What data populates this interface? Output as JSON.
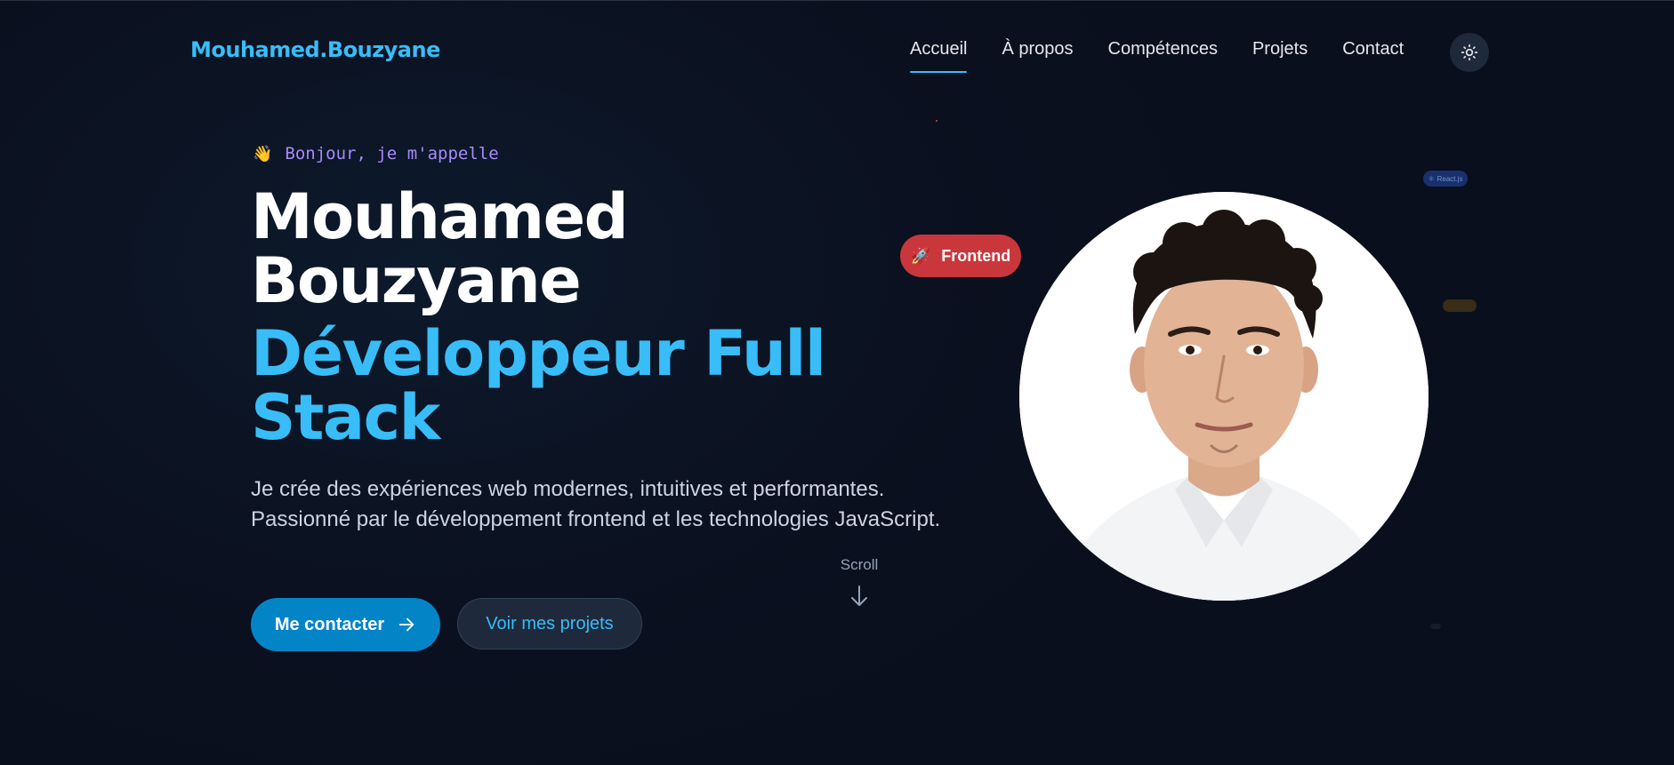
{
  "header": {
    "logo": "Mouhamed.Bouzyane",
    "nav": [
      "Accueil",
      "À propos",
      "Compétences",
      "Projets",
      "Contact"
    ],
    "active_nav": "Accueil",
    "theme_toggle_icon": "sun-icon"
  },
  "hero": {
    "greeting_icon": "👋",
    "greeting": "Bonjour, je m'appelle",
    "name": "Mouhamed Bouzyane",
    "role": "Développeur Full Stack",
    "description": "Je crée des expériences web modernes, intuitives et performantes. Passionné par le développement frontend et les technologies JavaScript.",
    "primary_button": "Me contacter",
    "secondary_button": "Voir mes projets",
    "scroll_label": "Scroll"
  },
  "profile": {
    "badge_icon": "🚀",
    "badge_label": "Frontend",
    "chips": [
      "React.js"
    ]
  },
  "colors": {
    "background": "#0b1120",
    "accent": "#38bdf8",
    "greeting": "#a78bfa",
    "primary_button": "#0284c7",
    "badge": "#c9373c"
  }
}
